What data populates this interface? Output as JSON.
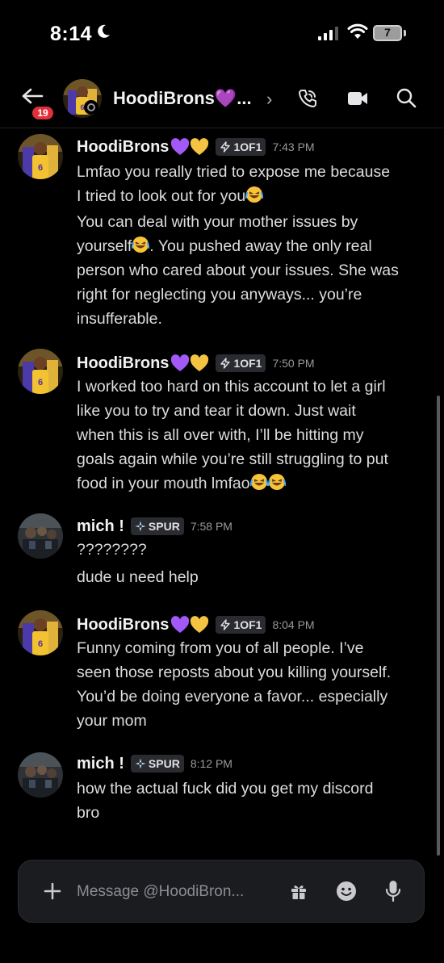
{
  "status_bar": {
    "time": "8:14",
    "battery": "7"
  },
  "header": {
    "unread_count": "19",
    "title": "HoodiBrons💜...",
    "chevron": "›"
  },
  "badges": {
    "heart_colors": [
      "#a259f7",
      "#f5c342"
    ]
  },
  "messages": [
    {
      "author": "HoodiBrons",
      "tag": "1OF1",
      "time": "7:43 PM",
      "lines": [
        "Lmfao you really tried to expose me because",
        "I tried to look out for you",
        "You can deal with your mother issues by",
        "yourself",
        ". You pushed away the only real",
        "person who cared about your issues. She was",
        "right for neglecting you anyways... you’re",
        "insufferable."
      ]
    },
    {
      "author": "HoodiBrons",
      "tag": "1OF1",
      "time": "7:50 PM",
      "lines": [
        "I worked too hard on this account to let a girl",
        "like you to try and tear it down. Just wait",
        "when this is all over with, I’ll be hitting my",
        "goals again while you’re still struggling to put",
        "food in your mouth lmfao"
      ]
    },
    {
      "author": "mich !",
      "tag": "SPUR",
      "time": "7:58 PM",
      "lines": [
        "????????",
        "dude u need help"
      ]
    },
    {
      "author": "HoodiBrons",
      "tag": "1OF1",
      "time": "8:04 PM",
      "lines": [
        "Funny coming from you of all people. I’ve",
        "seen those reposts about you killing yourself.",
        "You’d be doing everyone a favor... especially",
        "your mom"
      ]
    },
    {
      "author": "mich !",
      "tag": "SPUR",
      "time": "8:12 PM",
      "lines": [
        "how the actual fuck did you get my discord",
        "bro"
      ]
    }
  ],
  "composer": {
    "placeholder": "Message @HoodiBron..."
  },
  "icons": {
    "back": "back-arrow-icon",
    "call": "phone-icon",
    "video": "video-camera-icon",
    "search": "search-icon",
    "plus": "plus-icon",
    "gift": "gift-icon",
    "emoji": "emoji-icon",
    "mic": "microphone-icon",
    "moon": "moon-icon"
  }
}
